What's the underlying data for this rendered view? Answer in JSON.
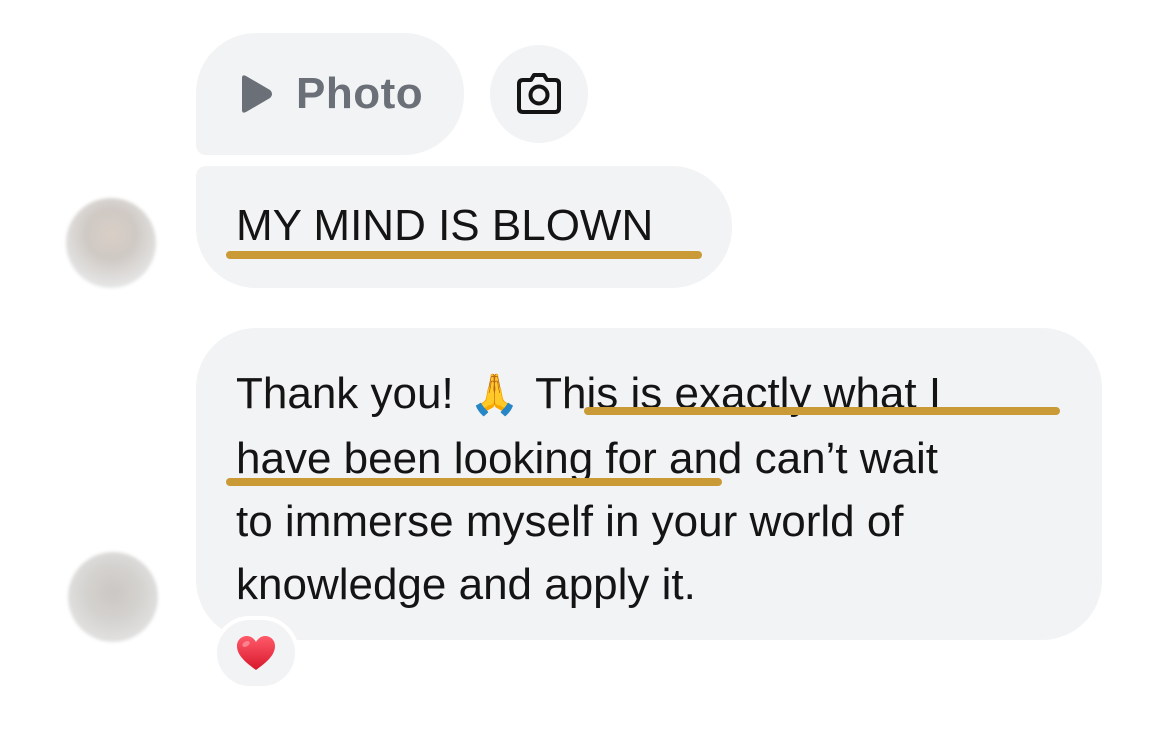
{
  "messages": {
    "photo_attachment": {
      "label": "Photo",
      "icon": "play-icon"
    },
    "camera_button": {
      "icon": "camera-icon"
    },
    "message_1": {
      "text": "MY MIND IS BLOWN",
      "highlight_color": "#c99a36"
    },
    "message_2": {
      "line_1_start": "Thank you!",
      "emoji": "🙏",
      "line_1_end": "This is exactly what I",
      "line_2": "have been looking for and can’t wait",
      "line_3": "to immerse myself in your world of",
      "line_4": "knowledge and apply it.",
      "reaction": "heart-icon",
      "highlight_color": "#c99a36"
    }
  },
  "colors": {
    "bubble_background": "#f2f3f5",
    "highlight": "#c99a36",
    "photo_label": "#6a6f78",
    "reaction_heart": "#e3263b"
  }
}
